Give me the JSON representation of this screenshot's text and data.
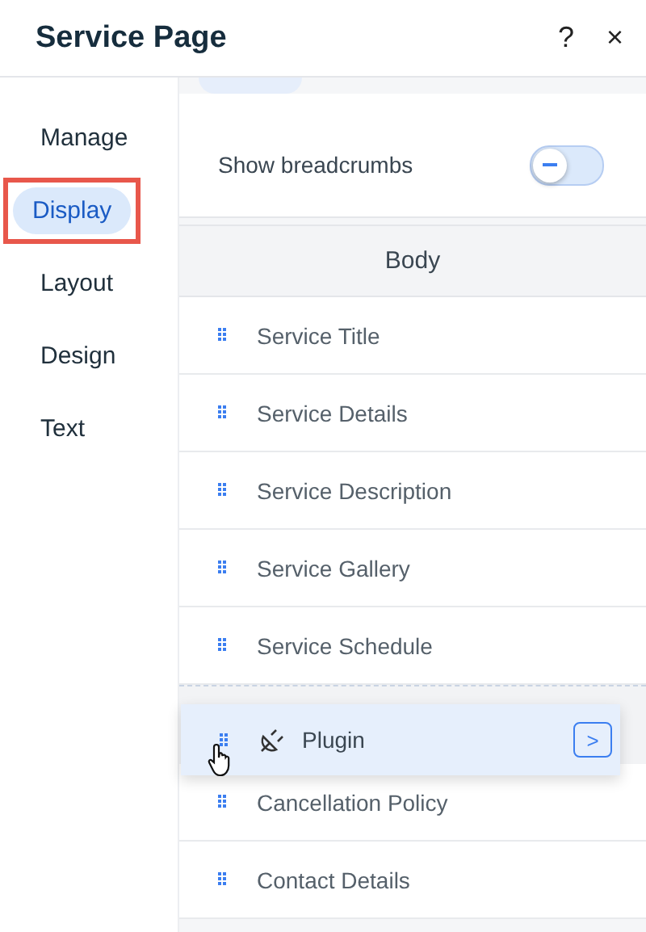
{
  "window": {
    "title": "Service Page",
    "help": "?",
    "close": "×"
  },
  "sidebar": {
    "items": [
      {
        "label": "Manage",
        "selected": false,
        "highlighted": false
      },
      {
        "label": "Display",
        "selected": true,
        "highlighted": true
      },
      {
        "label": "Layout",
        "selected": false,
        "highlighted": false
      },
      {
        "label": "Design",
        "selected": false,
        "highlighted": false
      },
      {
        "label": "Text",
        "selected": false,
        "highlighted": false
      }
    ]
  },
  "settings": [
    {
      "label": "Show breadcrumbs",
      "on": false
    }
  ],
  "section": {
    "title": "Body"
  },
  "rows": [
    {
      "kind": "item",
      "label": "Service Title"
    },
    {
      "kind": "item",
      "label": "Service Details"
    },
    {
      "kind": "item",
      "label": "Service Description"
    },
    {
      "kind": "item",
      "label": "Service Gallery"
    },
    {
      "kind": "item",
      "label": "Service Schedule"
    },
    {
      "kind": "slot"
    },
    {
      "kind": "item",
      "label": "Cancellation Policy"
    },
    {
      "kind": "item",
      "label": "Contact Details"
    }
  ],
  "dragged": {
    "label": "Plugin",
    "arrow": ">"
  }
}
